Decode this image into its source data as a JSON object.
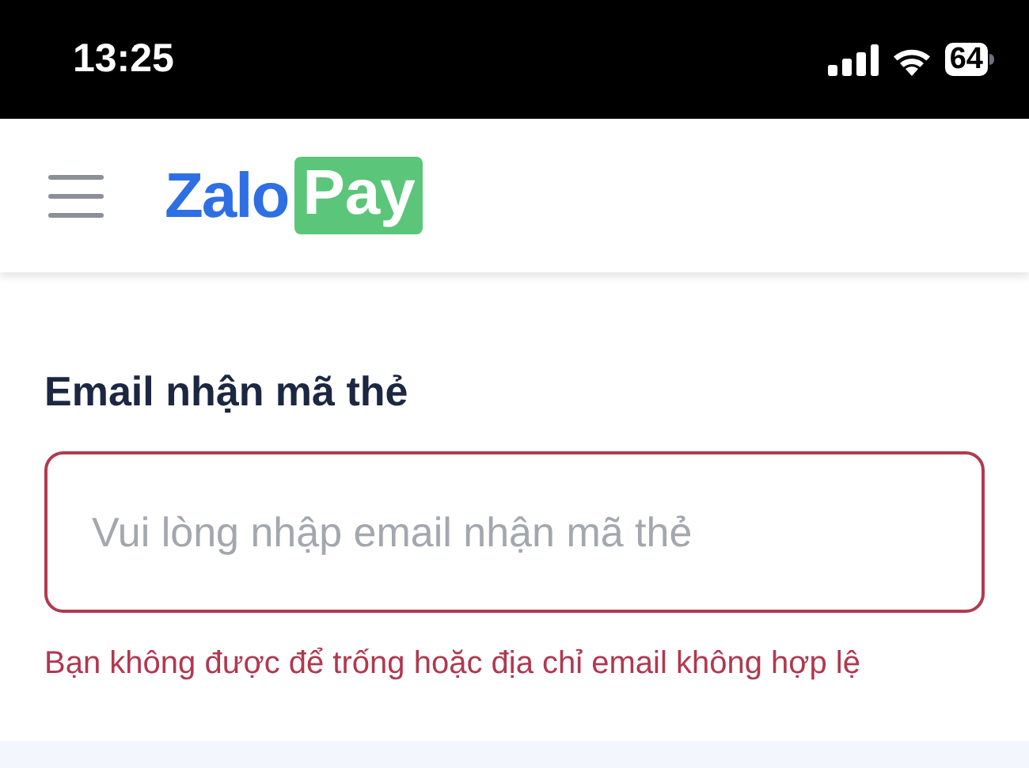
{
  "status_bar": {
    "time": "13:25",
    "battery": "64"
  },
  "header": {
    "logo": {
      "word": "Zalo",
      "tag": "Pay"
    }
  },
  "email_field": {
    "label": "Email nhận mã thẻ",
    "placeholder": "Vui lòng nhập email nhận mã thẻ",
    "invalid": true,
    "error": "Bạn không được để trống hoặc địa chỉ email không hợp lệ"
  }
}
